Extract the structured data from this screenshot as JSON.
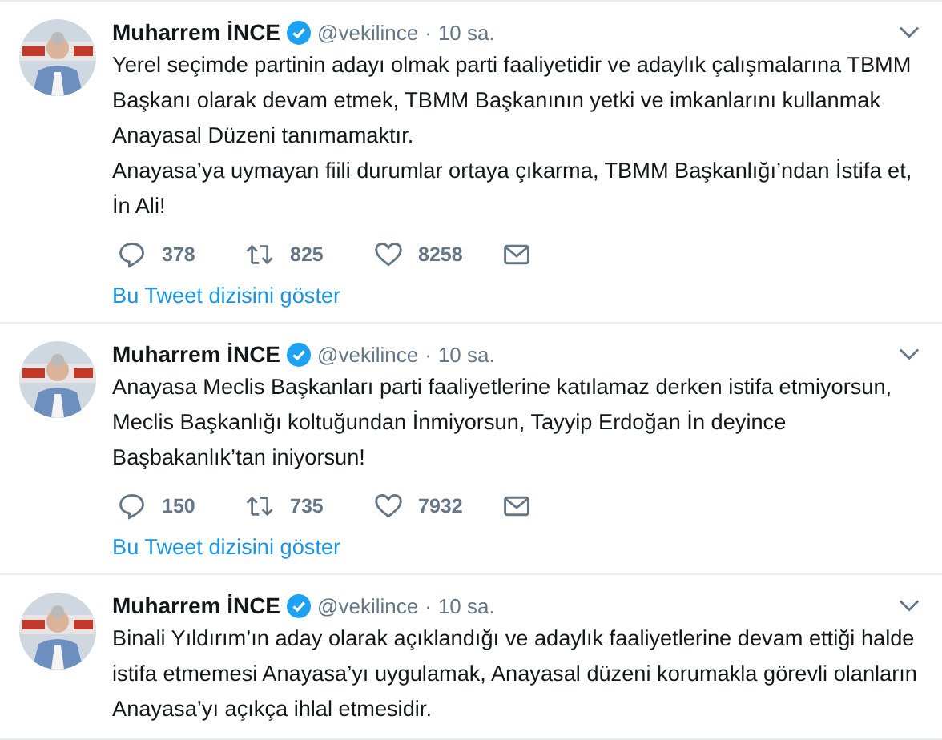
{
  "tweets": [
    {
      "name": "Muharrem İNCE",
      "verified": true,
      "handle": "@vekilince",
      "separator": "·",
      "time": "10 sa.",
      "paragraphs": [
        [
          "Yerel seçimde partinin adayı olmak parti faaliyetidir ve adaylık çalışmalarına TBMM",
          "Başkanı olarak devam etmek, TBMM Başkanının yetki ve imkanlarını kullanmak",
          "Anayasal Düzeni tanımamaktır."
        ],
        [
          "Anayasa’ya uymayan fiili durumlar ortaya çıkarma, TBMM Başkanlığı’ndan İstifa et,",
          "İn Ali!"
        ]
      ],
      "replies": "378",
      "retweets": "825",
      "likes": "8258",
      "thread_link": "Bu Tweet dizisini göster"
    },
    {
      "name": "Muharrem İNCE",
      "verified": true,
      "handle": "@vekilince",
      "separator": "·",
      "time": "10 sa.",
      "paragraphs": [
        [
          "Anayasa Meclis Başkanları parti faaliyetlerine katılamaz derken istifa etmiyorsun,",
          "Meclis Başkanlığı koltuğundan İnmiyorsun, Tayyip Erdoğan İn deyince",
          "Başbakanlık’tan iniyorsun!"
        ]
      ],
      "replies": "150",
      "retweets": "735",
      "likes": "7932",
      "thread_link": "Bu Tweet dizisini göster"
    },
    {
      "name": "Muharrem İNCE",
      "verified": true,
      "handle": "@vekilince",
      "separator": "·",
      "time": "10 sa.",
      "paragraphs": [
        [
          "Binali Yıldırım’ın aday olarak açıklandığı ve adaylık faaliyetlerine devam ettiği halde",
          "istifa etmemesi Anayasa’yı uygulamak, Anayasal düzeni korumakla görevli olanların",
          "Anayasa’yı açıkça ihlal etmesidir."
        ]
      ]
    }
  ]
}
